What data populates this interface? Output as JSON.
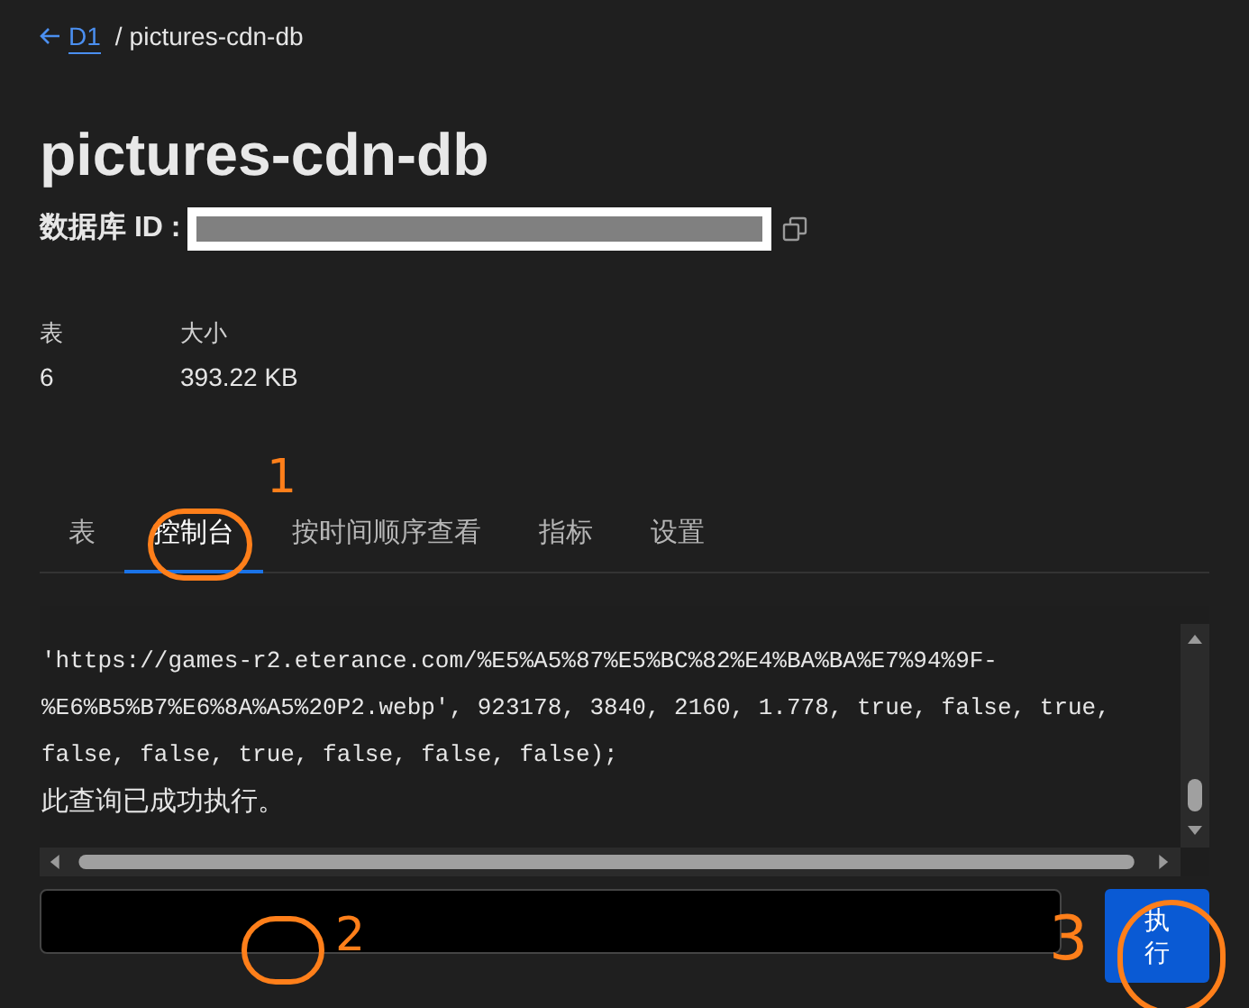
{
  "breadcrumb": {
    "back_link": "D1",
    "separator": "/",
    "current": "pictures-cdn-db"
  },
  "title": "pictures-cdn-db",
  "database_id": {
    "label": "数据库 ID :",
    "redacted": true
  },
  "stats": [
    {
      "label": "表",
      "value": "6"
    },
    {
      "label": "大小",
      "value": "393.22 KB"
    }
  ],
  "tabs": [
    {
      "label": "表",
      "selected": false
    },
    {
      "label": "控制台",
      "selected": true
    },
    {
      "label": "按时间顺序查看",
      "selected": false
    },
    {
      "label": "指标",
      "selected": false
    },
    {
      "label": "设置",
      "selected": false
    }
  ],
  "console": {
    "lines": [
      "'https://games-r2.eterance.com/%E5%A5%87%E5%BC%82%E4%BA%BA%E7%94%9F-",
      "%E6%B5%B7%E6%8A%A5%20P2.webp', 923178, 3840, 2160, 1.778, true, false, true,",
      "false, false, true, false, false, false);"
    ],
    "message": "此查询已成功执行。"
  },
  "run_button": {
    "label": "执行"
  },
  "annotations": [
    {
      "label": "1"
    },
    {
      "label": "2"
    },
    {
      "label": "3"
    }
  ]
}
